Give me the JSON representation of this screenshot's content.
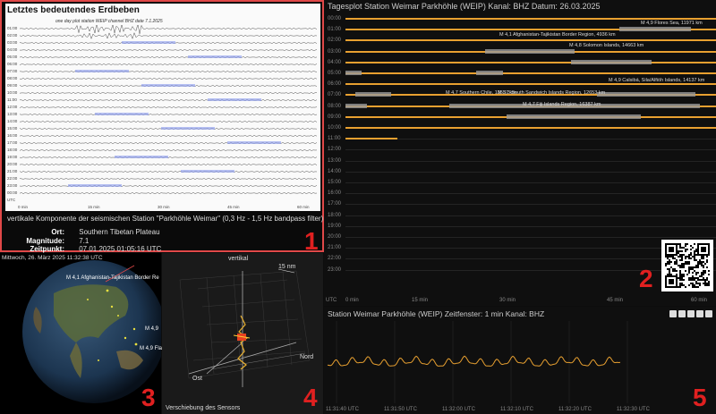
{
  "panel1": {
    "heading": "Letztes bedeutendes Erdbeben",
    "seismo_header": "one day plot station WEIP   channel BHZ   date 7.1.2025",
    "hours": [
      "01:00",
      "02:00",
      "03:00",
      "04:00",
      "05:00",
      "06:00",
      "07:00",
      "08:00",
      "09:00",
      "10:00",
      "11:00",
      "12:00",
      "13:00",
      "14:00",
      "15:00",
      "16:00",
      "17:00",
      "18:00",
      "19:00",
      "20:00",
      "21:00",
      "22:00",
      "23:00",
      "00:00",
      "UTC"
    ],
    "x_ticks": [
      "0 min",
      "15 min",
      "30 min",
      "45 min",
      "60 min"
    ],
    "caption": "vertikale Komponente der seismischen Station \"Parkhöhle Weimar\" (0,3 Hz - 1,5 Hz bandpass filter)",
    "ort_label": "Ort:",
    "ort_value": "Southern Tibetan Plateau",
    "mag_label": "Magnitude:",
    "mag_value": "7.1",
    "zeit_label": "Zeitpunkt:",
    "zeit_value": "07.01.2025    01:05:16 UTC",
    "badge": "1"
  },
  "panel2": {
    "title": "Tagesplot Station Weimar Parkhöhle (WEIP)  Kanal: BHZ  Datum: 26.03.2025",
    "hours": [
      "00:00",
      "01:00",
      "02:00",
      "03:00",
      "04:00",
      "05:00",
      "06:00",
      "07:00",
      "08:00",
      "09:00",
      "10:00",
      "11:00",
      "12:00",
      "13:00",
      "14:00",
      "15:00",
      "16:00",
      "17:00",
      "18:00",
      "19:00",
      "20:00",
      "21:00",
      "22:00",
      "23:00"
    ],
    "x_ticks": [
      "UTC",
      "0 min",
      "15 min",
      "30 min",
      "45 min",
      "60 min"
    ],
    "quakes": [
      {
        "label": "M 4,9 Flores Sea, 11971 km"
      },
      {
        "label": "M 4,1 Afghanistan-Tajikistan Border Region, 4936 km"
      },
      {
        "label": "M 4,8 Solomon Islands, 14663 km"
      },
      {
        "label": "M 4,9 Calsibá, Sila/Alfiöh Islands, 14137 km"
      },
      {
        "label": "M 4,7 Southern Chile, 13537 km"
      },
      {
        "label": "M 5,3 South Sandwich Islands Region, 12653 km"
      },
      {
        "label": "M 4,7 Fiji Islands Region, 16387 km"
      }
    ],
    "badge": "2",
    "qr_icon": "qr-code-icon"
  },
  "panel3": {
    "datetime": "Mittwoch, 26. März 2025    11:32:38 UTC",
    "labels": [
      "M 4,1 Afghanistan-Tajikistan Border Re",
      "M 4,9",
      "M 4,9 Fla"
    ],
    "badge": "3"
  },
  "panel4": {
    "axis_vertical": "vertikal",
    "axis_nord": "Nord",
    "axis_ost": "Ost",
    "scale": "15 nm",
    "caption": "Verschiebung des Sensors",
    "badge": "4"
  },
  "panel5": {
    "title": "Station Weimar Parkhöhle (WEIP)  Zeitfenster: 1 min  Kanal: BHZ",
    "x_ticks": [
      "11:31:40 UTC",
      "11:31:50 UTC",
      "11:32:00 UTC",
      "11:32:10 UTC",
      "11:32:20 UTC",
      "11:32:30 UTC"
    ],
    "badge": "5",
    "tools": [
      "image-icon",
      "zoom-icon",
      "pan-icon",
      "reset-icon",
      "edit-icon"
    ]
  }
}
